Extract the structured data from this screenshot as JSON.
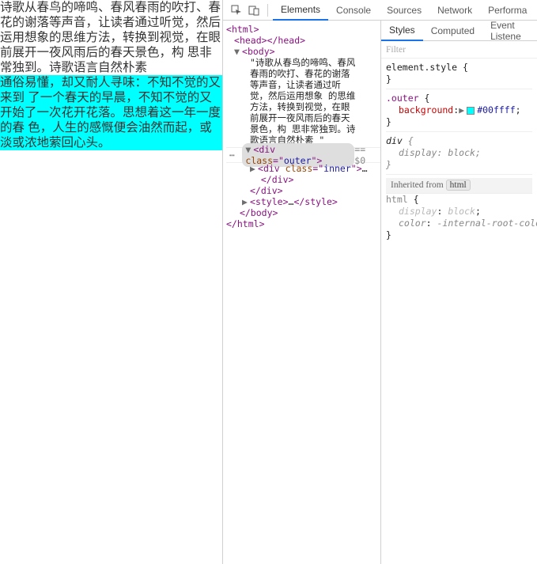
{
  "page": {
    "para1": "诗歌从春鸟的啼鸣、春风春雨的吹打、春花的谢落等声音，让读者通过听觉，然后运用想象的思维方法，转换到视觉，在眼前展开一夜风雨后的春天景色，构 思非常独到。诗歌语言自然朴素",
    "para2": "通俗易懂，却又耐人寻味：不知不觉的又来到 了一个春天的早晨，不知不觉的又开始了一次花开花落。思想着这一年一度的春 色，人生的感慨便会油然而起，或淡或浓地萦回心头。"
  },
  "toolbar": {
    "tabs": [
      "Elements",
      "Console",
      "Sources",
      "Network",
      "Performa"
    ],
    "active": 0
  },
  "elements": {
    "text_node": "\"诗歌从春鸟的啼鸣、春风春雨的吹打、春花的谢落等声音，让读者通过听觉，然后运用想象 的思维方法，转换到视觉，在眼前展开一夜风雨后的春天景色，构 思非常独到。诗歌语言自然朴素 \"",
    "outer_class": "outer",
    "inner_class": "inner",
    "sel_suffix": " == $0",
    "ellipsis": "…"
  },
  "styles": {
    "tabs": [
      "Styles",
      "Computed",
      "Event Listene"
    ],
    "active": 0,
    "filter_placeholder": "Filter",
    "rule_element": {
      "selector": "element.style",
      "props": []
    },
    "rule_outer": {
      "selector": ".outer",
      "prop": "background",
      "swatch": "#00ffff",
      "value": "#00ffff"
    },
    "rule_div": {
      "selector": "div",
      "prop": "display",
      "value": "block"
    },
    "inherited_from": "Inherited from",
    "inherited_chip": "html",
    "rule_html": {
      "selector": "html",
      "props": [
        {
          "prop": "display",
          "value": "block",
          "muted": true
        },
        {
          "prop": "color",
          "value": "-internal-root-color",
          "muted": false
        }
      ]
    }
  }
}
